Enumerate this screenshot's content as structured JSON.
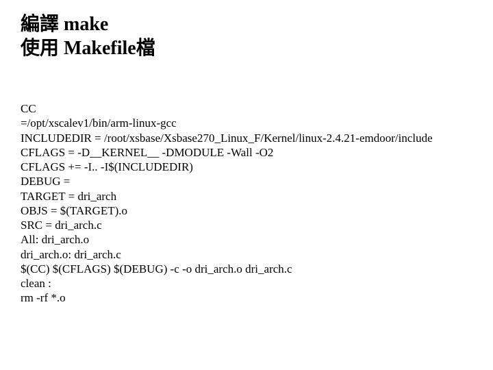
{
  "title": {
    "line1": "編譯 make",
    "line2": "使用 Makefile檔"
  },
  "code": {
    "l0": "CC",
    "l1": "=/opt/xscalev1/bin/arm-linux-gcc",
    "l2": "INCLUDEDIR = /root/xsbase/Xsbase270_Linux_F/Kernel/linux-2.4.21-emdoor/include",
    "l3": "CFLAGS = -D__KERNEL__ -DMODULE -Wall -O2",
    "l4": "CFLAGS += -I.. -I$(INCLUDEDIR)",
    "l5": "DEBUG =",
    "l6": "TARGET = dri_arch",
    "l7": "OBJS = $(TARGET).o",
    "l8": "SRC = dri_arch.c",
    "l9": "All: dri_arch.o",
    "l10": "dri_arch.o: dri_arch.c",
    "l11": "$(CC) $(CFLAGS) $(DEBUG) -c -o dri_arch.o dri_arch.c",
    "l12": "clean :",
    "l13": "rm -rf *.o"
  }
}
